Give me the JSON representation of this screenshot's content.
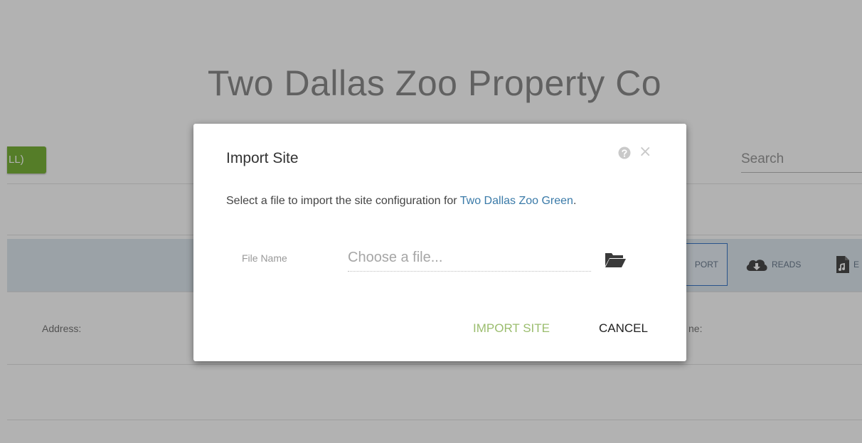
{
  "page": {
    "title": "Two Dallas Zoo Property Co",
    "all_button_label": "LL)",
    "search_placeholder": "Search",
    "export_button_label": "PORT",
    "reads_button_label": "READS",
    "doc_button_label": "E",
    "address_label": "Address:",
    "right_label": "ne:"
  },
  "modal": {
    "title": "Import Site",
    "message_prefix": "Select a file to import the site configuration for ",
    "site_name": "Two Dallas Zoo Green",
    "message_suffix": ".",
    "file_name_label": "File Name",
    "file_placeholder": "Choose a file...",
    "close_symbol": "×",
    "import_button_label": "IMPORT SITE",
    "cancel_button_label": "CANCEL"
  },
  "icons": {
    "help": "question-circle-icon",
    "close": "close-icon",
    "folder": "folder-open-icon",
    "reads": "cloud-download-icon",
    "doc": "file-icon"
  },
  "colors": {
    "accent_green": "#7ab43a",
    "import_text": "#9bbd6e",
    "link": "#3a7aa8",
    "export_border": "#3c78c8",
    "overlay": "rgba(0,0,0,0.30)"
  }
}
